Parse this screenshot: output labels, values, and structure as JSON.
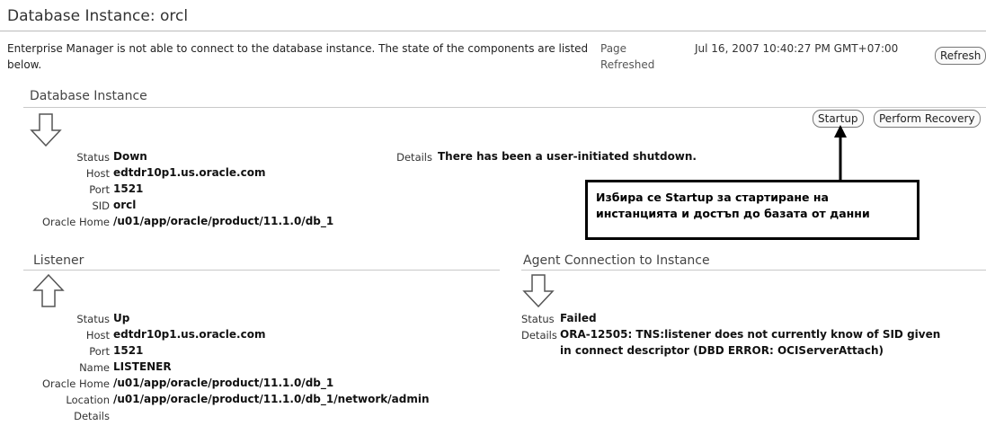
{
  "header": {
    "title": "Database Instance: orcl",
    "message": "Enterprise Manager is not able to connect to the database instance. The state of the components are listed below.",
    "page_refreshed_label": "Page Refreshed",
    "page_refreshed_value": "Jul 16, 2007 10:40:27 PM GMT+07:00",
    "refresh_button": "Refresh"
  },
  "db_instance": {
    "heading": "Database Instance",
    "startup_button": "Startup",
    "recovery_button": "Perform Recovery",
    "rows": [
      {
        "label": "Status",
        "value": "Down"
      },
      {
        "label": "Host",
        "value": "edtdr10p1.us.oracle.com"
      },
      {
        "label": "Port",
        "value": "1521"
      },
      {
        "label": "SID",
        "value": "orcl"
      },
      {
        "label": "Oracle Home",
        "value": "/u01/app/oracle/product/11.1.0/db_1"
      }
    ],
    "details_label": "Details",
    "details_value": "There has been a user-initiated shutdown."
  },
  "callout": {
    "text": "Избира се Startup за стартиране на инстанцията и достъп до базата от данни"
  },
  "listener": {
    "heading": "Listener",
    "rows": [
      {
        "label": "Status",
        "value": "Up"
      },
      {
        "label": "Host",
        "value": "edtdr10p1.us.oracle.com"
      },
      {
        "label": "Port",
        "value": "1521"
      },
      {
        "label": "Name",
        "value": "LISTENER"
      },
      {
        "label": "Oracle Home",
        "value": "/u01/app/oracle/product/11.1.0/db_1"
      },
      {
        "label": "Location",
        "value": "/u01/app/oracle/product/11.1.0/db_1/network/admin"
      },
      {
        "label": "Details",
        "value": ""
      }
    ]
  },
  "agent": {
    "heading": "Agent Connection to Instance",
    "status_label": "Status",
    "status_value": "Failed",
    "details_label": "Details",
    "details_line1": "ORA-12505: TNS:listener does not currently know of SID given",
    "details_line2": "in connect descriptor (DBD ERROR: OCIServerAttach)"
  },
  "icons": {
    "db_status": "down-arrow-icon",
    "listener_status": "up-arrow-icon",
    "agent_status": "down-arrow-icon",
    "callout_pointer": "pointer-arrow-icon"
  }
}
